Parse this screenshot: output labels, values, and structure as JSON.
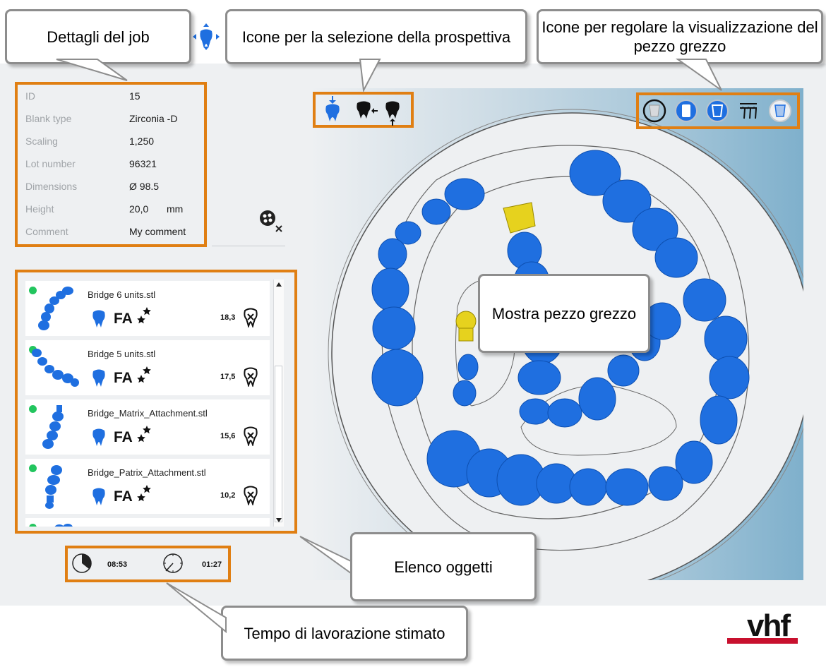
{
  "callouts": {
    "job_details": "Dettagli del job",
    "perspective": "Icone per la selezione della prospettiva",
    "blank_view": "Icone per regolare la visualizzazione del pezzo grezzo",
    "show_blank": "Mostra pezzo grezzo",
    "object_list": "Elenco oggetti",
    "est_time": "Tempo di lavorazione stimato"
  },
  "job": {
    "rows": [
      {
        "label": "ID",
        "value": "15"
      },
      {
        "label": "Blank type",
        "value": "Zirconia -D"
      },
      {
        "label": "Scaling",
        "value": "1,250"
      },
      {
        "label": "Lot number",
        "value": "96321"
      },
      {
        "label": "Dimensions",
        "value": "Ø 98.5"
      },
      {
        "label": "Height",
        "value": "20,0"
      },
      {
        "label": "Comment",
        "value": "My comment"
      }
    ],
    "height_unit": "mm"
  },
  "objects": [
    {
      "name": "Bridge 6 units.stl",
      "badge": "FA",
      "value": "18,3"
    },
    {
      "name": "Bridge 5 units.stl",
      "badge": "FA",
      "value": "17,5"
    },
    {
      "name": "Bridge_Matrix_Attachment.stl",
      "badge": "FA",
      "value": "15,6"
    },
    {
      "name": "Bridge_Patrix_Attachment.stl",
      "badge": "FA",
      "value": "10,2"
    }
  ],
  "times": {
    "total": "08:53",
    "remaining": "01:27"
  },
  "colors": {
    "accent": "#e07f13",
    "tooth_blue": "#1f6fe0",
    "status_green": "#22c55e",
    "logo_red": "#c8102e"
  },
  "logo": {
    "text": "vhf"
  },
  "icons": {
    "header": "move-arrows-tooth-icon",
    "perspective": [
      "top-view-icon",
      "side-view-icon",
      "bottom-view-icon"
    ],
    "blank_view": [
      "blank-outline-icon",
      "blank-white-icon",
      "blank-solid-icon",
      "bridge-framework-icon",
      "blank-transparent-icon"
    ],
    "clear_selection": "clear-selection-icon"
  }
}
